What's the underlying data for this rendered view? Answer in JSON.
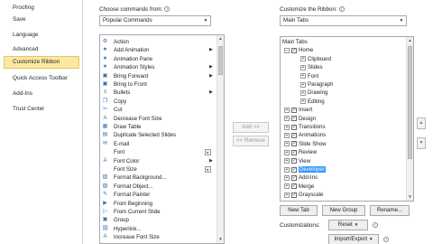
{
  "nav": {
    "items": [
      {
        "label": "Proofing",
        "selected": false
      },
      {
        "label": "Save",
        "selected": false
      },
      {
        "label": "Language",
        "selected": false
      },
      {
        "label": "Advanced",
        "selected": false
      },
      {
        "label": "Customize Ribbon",
        "selected": true
      },
      {
        "label": "Quick Access Toolbar",
        "selected": false
      },
      {
        "label": "Add-Ins",
        "selected": false
      },
      {
        "label": "Trust Center",
        "selected": false
      }
    ]
  },
  "left_panel": {
    "label": "Choose commands from:",
    "dropdown_value": "Popular Commands",
    "commands": [
      {
        "label": "Action",
        "icon": "⚙",
        "submenu": false
      },
      {
        "label": "Add Animation",
        "icon": "★",
        "submenu": true
      },
      {
        "label": "Animation Pane",
        "icon": "★",
        "submenu": false
      },
      {
        "label": "Animation Styles",
        "icon": "★",
        "submenu": true
      },
      {
        "label": "Bring Forward",
        "icon": "▣",
        "submenu": true
      },
      {
        "label": "Bring to Front",
        "icon": "▣",
        "submenu": false
      },
      {
        "label": "Bullets",
        "icon": "≡",
        "submenu": true
      },
      {
        "label": "Copy",
        "icon": "❐",
        "submenu": false
      },
      {
        "label": "Cut",
        "icon": "✂",
        "submenu": false
      },
      {
        "label": "Decrease Font Size",
        "icon": "A",
        "submenu": false
      },
      {
        "label": "Draw Table",
        "icon": "▦",
        "submenu": false
      },
      {
        "label": "Duplicate Selected Slides",
        "icon": "▤",
        "submenu": false
      },
      {
        "label": "E-mail",
        "icon": "✉",
        "submenu": false
      },
      {
        "label": "Font",
        "icon": "",
        "submenu": false,
        "expander": true
      },
      {
        "label": "Font Color",
        "icon": "A",
        "submenu": true
      },
      {
        "label": "Font Size",
        "icon": "",
        "submenu": false,
        "expander": true
      },
      {
        "label": "Format Background...",
        "icon": "▨",
        "submenu": false
      },
      {
        "label": "Format Object...",
        "icon": "▧",
        "submenu": false
      },
      {
        "label": "Format Painter",
        "icon": "✎",
        "submenu": false
      },
      {
        "label": "From Beginning",
        "icon": "▶",
        "submenu": false
      },
      {
        "label": "From Current Slide",
        "icon": "▷",
        "submenu": false
      },
      {
        "label": "Group",
        "icon": "▣",
        "submenu": false
      },
      {
        "label": "Hyperlink...",
        "icon": "⛓",
        "submenu": false
      },
      {
        "label": "Increase Font Size",
        "icon": "A",
        "submenu": false
      }
    ]
  },
  "middle": {
    "add_label": "Add >>",
    "remove_label": "<< Remove"
  },
  "right_panel": {
    "label": "Customize the Ribbon:",
    "dropdown_value": "Main Tabs",
    "tree": [
      {
        "label": "Main Tabs",
        "level": 0,
        "checkbox": false,
        "expander": ""
      },
      {
        "label": "Home",
        "level": 1,
        "checkbox": true,
        "expander": "−"
      },
      {
        "label": "Clipboard",
        "level": 2,
        "checkbox": false,
        "expander": "+"
      },
      {
        "label": "Slides",
        "level": 2,
        "checkbox": false,
        "expander": "+"
      },
      {
        "label": "Font",
        "level": 2,
        "checkbox": false,
        "expander": "+"
      },
      {
        "label": "Paragraph",
        "level": 2,
        "checkbox": false,
        "expander": "+"
      },
      {
        "label": "Drawing",
        "level": 2,
        "checkbox": false,
        "expander": "+"
      },
      {
        "label": "Editing",
        "level": 2,
        "checkbox": false,
        "expander": "+"
      },
      {
        "label": "Insert",
        "level": 1,
        "checkbox": true,
        "expander": "+"
      },
      {
        "label": "Design",
        "level": 1,
        "checkbox": true,
        "expander": "+"
      },
      {
        "label": "Transitions",
        "level": 1,
        "checkbox": true,
        "expander": "+"
      },
      {
        "label": "Animations",
        "level": 1,
        "checkbox": true,
        "expander": "+"
      },
      {
        "label": "Slide Show",
        "level": 1,
        "checkbox": true,
        "expander": "+"
      },
      {
        "label": "Review",
        "level": 1,
        "checkbox": true,
        "expander": "+"
      },
      {
        "label": "View",
        "level": 1,
        "checkbox": true,
        "expander": "+"
      },
      {
        "label": "Developer",
        "level": 1,
        "checkbox": true,
        "expander": "+",
        "highlight": true
      },
      {
        "label": "Add-Ins",
        "level": 1,
        "checkbox": true,
        "expander": "+"
      },
      {
        "label": "Merge",
        "level": 1,
        "checkbox": true,
        "expander": "+"
      },
      {
        "label": "Grayscale",
        "level": 1,
        "checkbox": true,
        "expander": "+"
      }
    ],
    "new_tab_label": "New Tab",
    "new_group_label": "New Group",
    "rename_label": "Rename...",
    "customizations_label": "Customizations:",
    "reset_label": "Reset",
    "import_export_label": "Import/Export"
  },
  "colors": {
    "accent_selected": "#fbe8a3",
    "highlight": "#3399ff"
  }
}
